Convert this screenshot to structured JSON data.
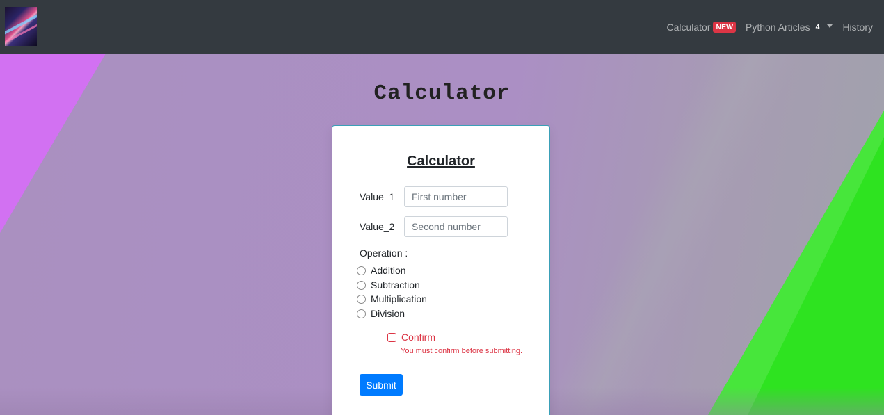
{
  "navbar": {
    "logo_alt": "site logo",
    "items": [
      {
        "label": "Calculator",
        "badge": "NEW",
        "badge_color": "#dc3545"
      },
      {
        "label": "Python Articles",
        "count": "4",
        "has_dropdown": true
      },
      {
        "label": "History"
      }
    ]
  },
  "page": {
    "title": "Calculator"
  },
  "form": {
    "title": "Calculator",
    "value1": {
      "label": "Value_1",
      "placeholder": "First number",
      "value": ""
    },
    "value2": {
      "label": "Value_2",
      "placeholder": "Second number",
      "value": ""
    },
    "operation_label": "Operation :",
    "operations": [
      "Addition",
      "Subtraction",
      "Multiplication",
      "Division"
    ],
    "selected_operation": null,
    "confirm": {
      "label": "Confirm",
      "checked": false,
      "error": "You must confirm before submitting."
    },
    "submit_label": "Submit"
  },
  "colors": {
    "navbar": "#343a40",
    "primary": "#007bff",
    "danger": "#dc3545",
    "accent_pink": "#d271f2",
    "accent_green": "#2ee320"
  }
}
